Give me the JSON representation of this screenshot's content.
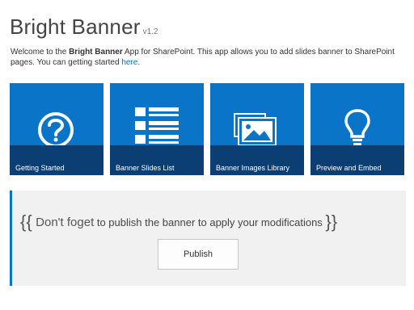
{
  "header": {
    "title": "Bright Banner",
    "version": "v1.2"
  },
  "intro": {
    "prefix": "Welcome to the ",
    "app_name": "Bright Banner",
    "suffix": " App for SharePoint. This app allows you to add slides banner to SharePoint pages. You can getting started ",
    "link_text": "here",
    "end": "."
  },
  "tiles": [
    {
      "label": "Getting Started",
      "icon": "question-circle-icon"
    },
    {
      "label": "Banner Slides List",
      "icon": "list-icon"
    },
    {
      "label": "Banner Images Library",
      "icon": "image-library-icon"
    },
    {
      "label": "Preview and Embed",
      "icon": "lightbulb-icon"
    }
  ],
  "notice": {
    "open_brace": "{{",
    "lead": "Don't foget",
    "message": " to publish the banner to apply your modifications ",
    "close_brace": "}}",
    "button_label": "Publish"
  },
  "colors": {
    "tile_blue": "#0a74c9",
    "tile_caption": "#0b3f73",
    "link": "#0072c6",
    "notice_bg": "#f1f1f1"
  }
}
